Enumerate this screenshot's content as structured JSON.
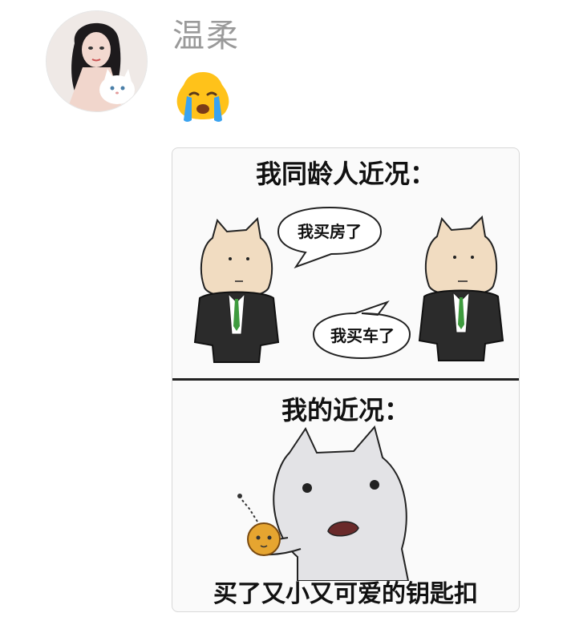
{
  "message": {
    "sender_name": "温柔",
    "emoji": "loudly-crying-face"
  },
  "meme": {
    "panel1_title": "我同龄人近况：",
    "bubble1": "我买房了",
    "bubble2": "我买车了",
    "panel2_title": "我的近况：",
    "caption": "买了又小又可爱的钥匙扣"
  }
}
